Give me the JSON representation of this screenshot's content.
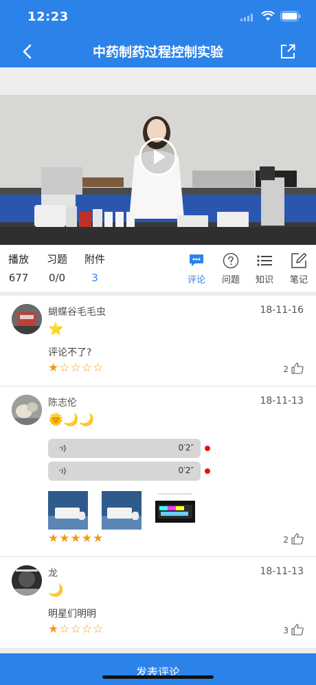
{
  "status": {
    "time": "12:23"
  },
  "nav": {
    "title": "中药制药过程控制实验"
  },
  "stats": [
    {
      "label": "播放",
      "value": "677"
    },
    {
      "label": "习题",
      "value": "0/0"
    },
    {
      "label": "附件",
      "value": "3"
    }
  ],
  "tabs": [
    {
      "label": "评论",
      "icon": "comment-icon",
      "active": true
    },
    {
      "label": "问题",
      "icon": "question-icon",
      "active": false
    },
    {
      "label": "知识",
      "icon": "list-icon",
      "active": false
    },
    {
      "label": "笔记",
      "icon": "note-edit-icon",
      "active": false
    }
  ],
  "comments": [
    {
      "name": "蝴蝶谷毛毛虫",
      "date": "18-11-16",
      "emoji": "⭐",
      "text": "评论不了?",
      "rating": 1,
      "likes": "2"
    },
    {
      "name": "陈志伦",
      "date": "18-11-13",
      "emoji": "🌞🌙🌙",
      "voices": [
        {
          "duration": "0′2″"
        },
        {
          "duration": "0′2″"
        }
      ],
      "rating": 5,
      "likes": "2"
    },
    {
      "name": "龙",
      "date": "18-11-13",
      "emoji": "🌙",
      "text": "明星们明明",
      "rating": 1,
      "likes": "3"
    }
  ],
  "footer": {
    "submit_label": "发表评论"
  },
  "colors": {
    "primary": "#2b83ea",
    "star": "#f29a11",
    "voice_dot": "#e11111"
  }
}
